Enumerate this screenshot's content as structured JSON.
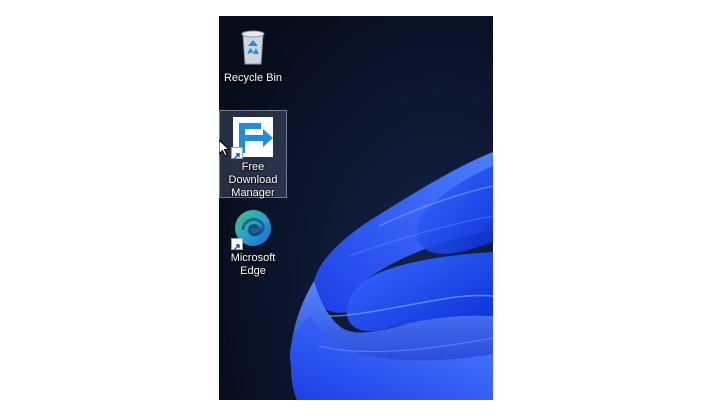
{
  "desktop": {
    "icons": [
      {
        "label": "Recycle Bin",
        "icon": "recycle-bin-icon",
        "shortcut": false,
        "selected": false
      },
      {
        "label": "Free Download Manager",
        "label_lines": [
          "Free",
          "Download",
          "Manager"
        ],
        "icon": "free-download-manager-icon",
        "shortcut": true,
        "selected": true
      },
      {
        "label": "Microsoft Edge",
        "label_lines": [
          "Microsoft",
          "Edge"
        ],
        "icon": "microsoft-edge-icon",
        "shortcut": true,
        "selected": false
      }
    ]
  },
  "colors": {
    "wallpaper_bg": "#0a1120",
    "bloom_blue": "#1e4fff",
    "fdm_blue": "#1f8ed8",
    "edge_blue": "#1f7fd6",
    "edge_green": "#46c07a"
  }
}
